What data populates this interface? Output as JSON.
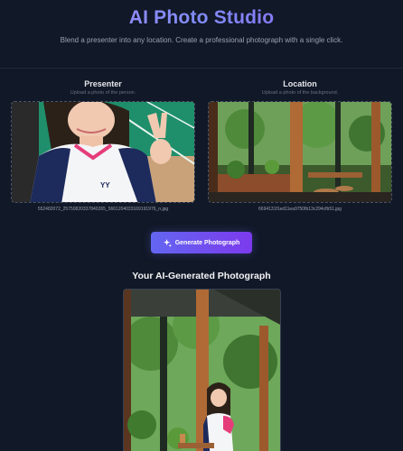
{
  "header": {
    "title": "AI Photo Studio",
    "subtitle": "Blend a presenter into any location. Create a professional photograph with a single click."
  },
  "presenter": {
    "title": "Presenter",
    "hint": "Upload a photo of the person.",
    "filename": "552482072_25750820337840265_5661204033169191976_n.jpg"
  },
  "location": {
    "title": "Location",
    "hint": "Upload a photo of the background.",
    "filename": "6694131f1ed11ea9750fb13c294cfb51.jpg"
  },
  "generate_button": {
    "label": "Generate Photograph",
    "icon": "sparkles-icon"
  },
  "result": {
    "title": "Your AI-Generated Photograph"
  },
  "colors": {
    "background": "#111827",
    "accent": "#6366f1",
    "title_gradient_start": "#a78bfa",
    "title_gradient_end": "#8b5cf6"
  }
}
